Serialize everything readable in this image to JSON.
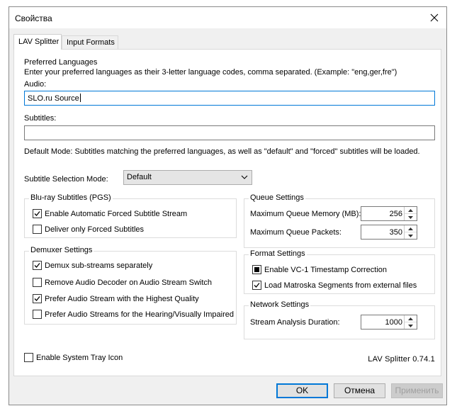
{
  "window": {
    "title": "Свойства"
  },
  "tabs": [
    {
      "label": "LAV Splitter",
      "active": true
    },
    {
      "label": "Input Formats",
      "active": false
    }
  ],
  "languages": {
    "heading": "Preferred Languages",
    "description": "Enter your preferred languages as their 3-letter language codes, comma separated. (Example: \"eng,ger,fre\")",
    "audio_label": "Audio:",
    "audio_value": "SLO.ru Source",
    "subtitles_label": "Subtitles:",
    "subtitles_value": "",
    "default_mode_text": "Default Mode: Subtitles matching the preferred languages, as well as \"default\" and \"forced\" subtitles will be loaded."
  },
  "subtitle_mode": {
    "label": "Subtitle Selection Mode:",
    "value": "Default"
  },
  "bluray": {
    "title": "Blu-ray Subtitles (PGS)",
    "items": [
      {
        "label": "Enable Automatic Forced Subtitle Stream",
        "state": "checked"
      },
      {
        "label": "Deliver only Forced Subtitles",
        "state": "unchecked"
      }
    ]
  },
  "demuxer": {
    "title": "Demuxer Settings",
    "items": [
      {
        "label": "Demux sub-streams separately",
        "state": "checked"
      },
      {
        "label": "Remove Audio Decoder on Audio Stream Switch",
        "state": "unchecked"
      },
      {
        "label": "Prefer Audio Stream with the Highest Quality",
        "state": "checked"
      },
      {
        "label": "Prefer Audio Streams for the Hearing/Visually Impaired",
        "state": "unchecked"
      }
    ]
  },
  "queue": {
    "title": "Queue Settings",
    "memory_label": "Maximum Queue Memory (MB):",
    "memory_value": "256",
    "packets_label": "Maximum Queue Packets:",
    "packets_value": "350"
  },
  "format": {
    "title": "Format Settings",
    "items": [
      {
        "label": "Enable VC-1 Timestamp Correction",
        "state": "indeterminate"
      },
      {
        "label": "Load Matroska Segments from external files",
        "state": "checked"
      }
    ]
  },
  "network": {
    "title": "Network Settings",
    "duration_label": "Stream Analysis Duration:",
    "duration_value": "1000"
  },
  "tray": {
    "label": "Enable System Tray Icon",
    "state": "unchecked"
  },
  "version": "LAV Splitter 0.74.1",
  "buttons": {
    "ok": "OK",
    "cancel": "Отмена",
    "apply": "Применить"
  },
  "colors": {
    "accent": "#0078d7",
    "disabled_text": "#a0a0a0"
  },
  "icons": {
    "close": "close-icon",
    "dropdown": "chevron-down-icon",
    "checkmark": "checkmark-icon"
  }
}
